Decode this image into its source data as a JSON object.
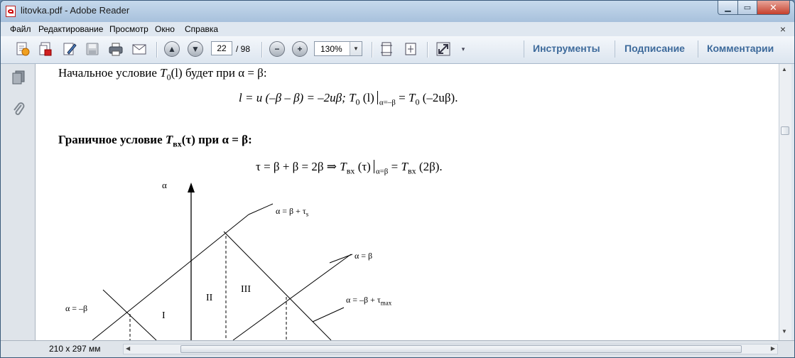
{
  "window": {
    "title": "litovka.pdf - Adobe Reader"
  },
  "menu": {
    "items": [
      {
        "key": "file",
        "label": "Файл"
      },
      {
        "key": "edit",
        "label": "Редактирование"
      },
      {
        "key": "view",
        "label": "Просмотр"
      },
      {
        "key": "window",
        "label": "Окно"
      },
      {
        "key": "help",
        "label": "Справка"
      }
    ],
    "close_glyph": "×"
  },
  "toolbar": {
    "page_current": "22",
    "page_total": "/ 98",
    "zoom": "130%",
    "links": {
      "tools": "Инструменты",
      "sign": "Подписание",
      "comment": "Комментарии"
    }
  },
  "document": {
    "line1_prefix": "Начальное условие ",
    "line1_T": "T",
    "line1_sub": "0",
    "line1_arg": "(l)",
    "line1_suffix": " будет при α = β:",
    "eq1_a": "l = u (–β – β) = –2uβ; ",
    "eq1_T": "T",
    "eq1_sub": "0",
    "eq1_b": " (l)",
    "eq1_cond": "α=–β",
    "eq1_c": " = ",
    "eq1_T2": "T",
    "eq1_sub2": "0",
    "eq1_d": " (–2uβ).",
    "heading_prefix": "Граничное условие ",
    "heading_T": "T",
    "heading_sub": "вх",
    "heading_suffix": "(τ) при α = β:",
    "eq2_a": "τ = β + β = 2β ⇒ ",
    "eq2_T": "T",
    "eq2_sub": "вх",
    "eq2_b": " (τ)",
    "eq2_cond": "α=β",
    "eq2_c": " = ",
    "eq2_T2": "T",
    "eq2_sub2": "вх",
    "eq2_d": " (2β).",
    "diagram": {
      "axis_label": "α",
      "label_top": "α = β + τ",
      "label_top_sub": "s",
      "label_mid": "α = β",
      "label_left": "α = –β",
      "label_right": "α = –β + τ",
      "label_right_sub": "max",
      "region_1": "I",
      "region_2": "II",
      "region_3": "III"
    }
  },
  "status": {
    "page_size": "210 x 297 мм"
  }
}
